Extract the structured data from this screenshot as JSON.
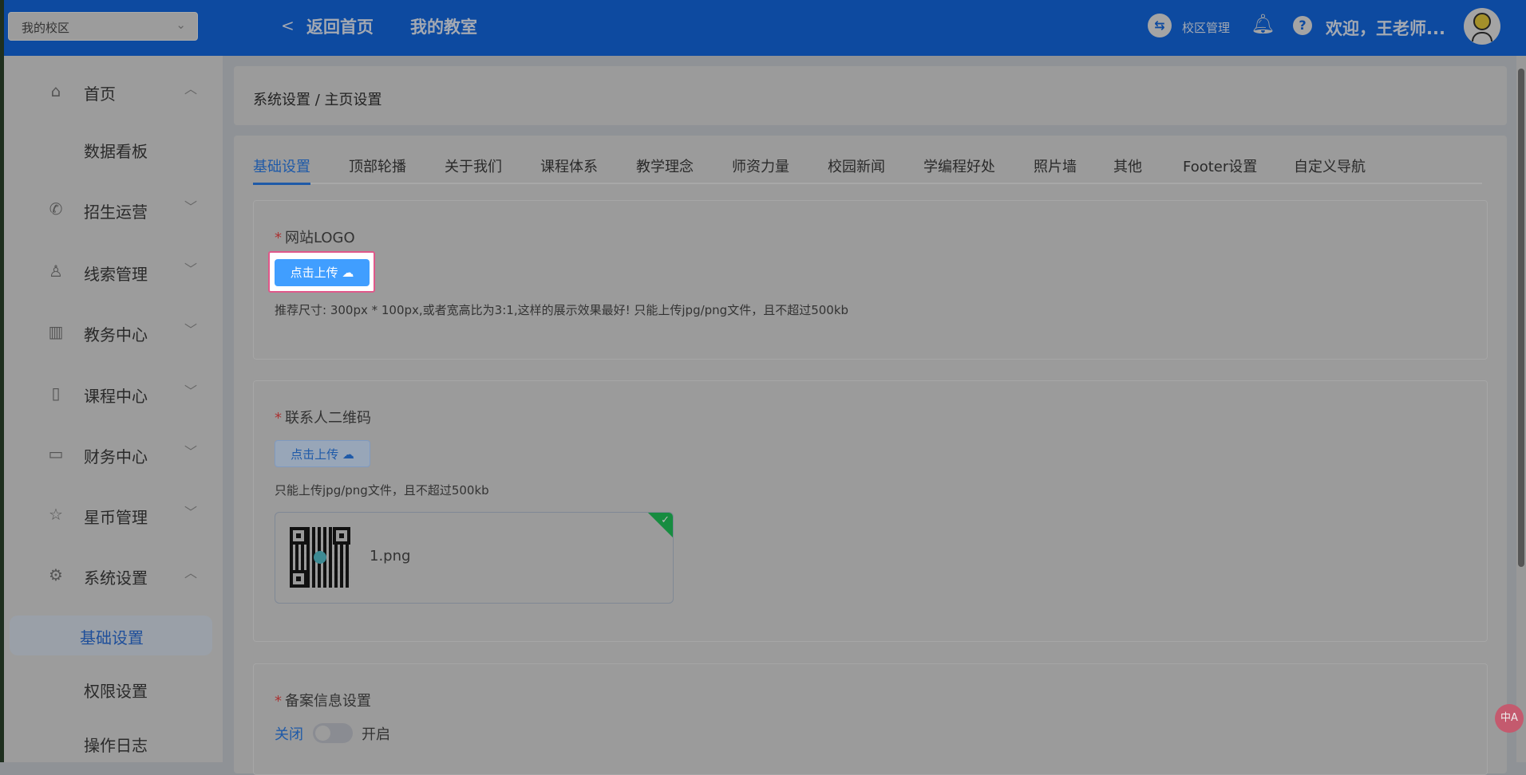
{
  "header": {
    "campus_select": "我的校区",
    "back_label": "返回首页",
    "my_classroom": "我的教室",
    "campus_manage": "校区管理",
    "welcome": "欢迎，王老师..."
  },
  "sidebar": {
    "items": [
      {
        "label": "首页",
        "icon": "home-icon",
        "arrow": "^"
      },
      {
        "label": "数据看板"
      },
      {
        "label": "招生运营",
        "icon": "phone-icon",
        "arrow": "v"
      },
      {
        "label": "线索管理",
        "icon": "user-icon",
        "arrow": "v"
      },
      {
        "label": "教务中心",
        "icon": "building-icon",
        "arrow": "v"
      },
      {
        "label": "课程中心",
        "icon": "notebook-icon",
        "arrow": "v"
      },
      {
        "label": "财务中心",
        "icon": "card-icon",
        "arrow": "v"
      },
      {
        "label": "星币管理",
        "icon": "star-icon",
        "arrow": "v"
      },
      {
        "label": "系统设置",
        "icon": "gear-icon",
        "arrow": "^"
      },
      {
        "label": "基础设置"
      },
      {
        "label": "权限设置"
      },
      {
        "label": "操作日志"
      }
    ]
  },
  "breadcrumb": "系统设置 / 主页设置",
  "tabs": [
    "基础设置",
    "顶部轮播",
    "关于我们",
    "课程体系",
    "教学理念",
    "师资力量",
    "校园新闻",
    "学编程好处",
    "照片墙",
    "其他",
    "Footer设置",
    "自定义导航"
  ],
  "logo_section": {
    "label": "网站LOGO",
    "upload": "点击上传",
    "hint": "推荐尺寸: 300px * 100px,或者宽高比为3:1,这样的展示效果最好!     只能上传jpg/png文件，且不超过500kb"
  },
  "qr_section": {
    "label": "联系人二维码",
    "upload": "点击上传",
    "hint": "只能上传jpg/png文件，且不超过500kb",
    "file_name": "1.png"
  },
  "icp_section": {
    "label": "备案信息设置",
    "off": "关闭",
    "on": "开启"
  },
  "translate_badge": "中A",
  "colors": {
    "header": "#0d4aa0",
    "accent": "#409eff",
    "highlight": "#e0588a",
    "success": "#178c40"
  }
}
